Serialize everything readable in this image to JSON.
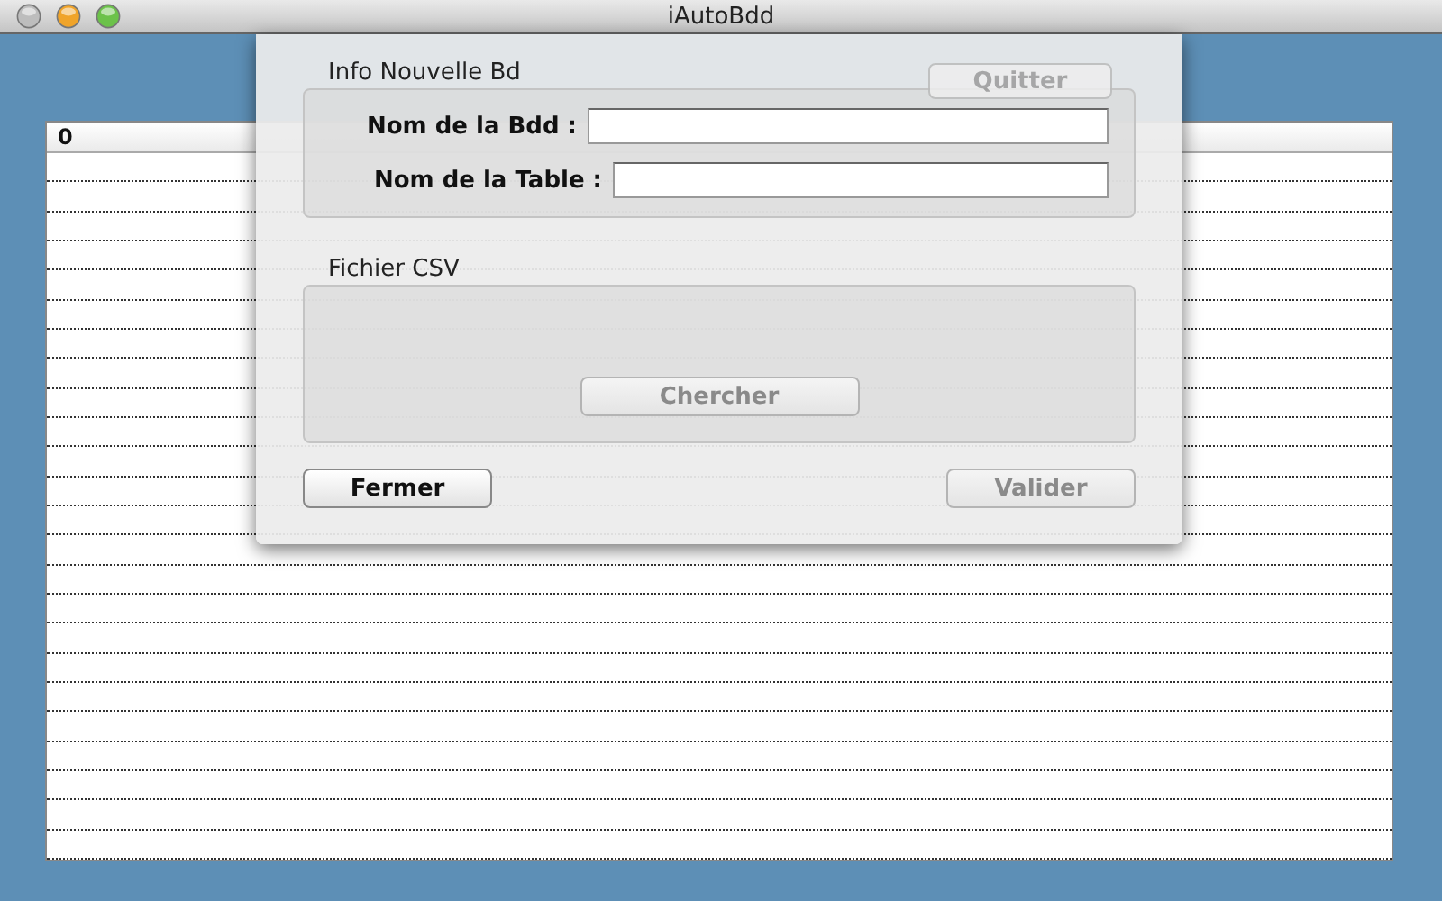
{
  "window": {
    "title": "iAutoBdd"
  },
  "toolbar": {
    "quit_button": {
      "label": "Quitter",
      "disabled": true
    }
  },
  "table": {
    "columns": [
      "0"
    ]
  },
  "sheet": {
    "info_group": {
      "title": "Info Nouvelle Bd",
      "fields": [
        {
          "label": "Nom de la Bdd :"
        },
        {
          "label": "Nom de la Table :"
        }
      ]
    },
    "csv_group": {
      "title": "Fichier CSV",
      "button": {
        "label": "Chercher",
        "disabled": true
      }
    },
    "buttons": [
      {
        "label": "Fermer",
        "disabled": false
      },
      {
        "label": "Valider",
        "disabled": true
      }
    ]
  }
}
